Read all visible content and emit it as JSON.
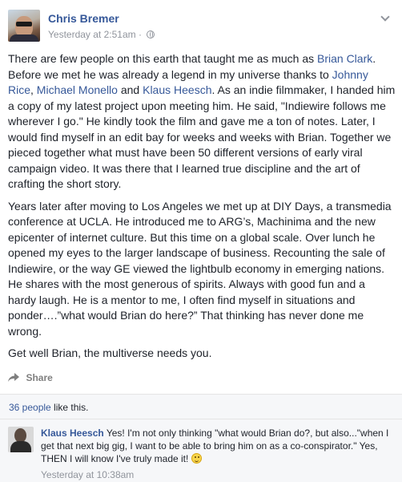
{
  "post": {
    "author": "Chris Bremer",
    "timestamp": "Yesterday at 2:51am",
    "separator": "·",
    "privacy_icon": "globe-icon",
    "options_icon": "chevron-down-icon",
    "paragraphs": [
      {
        "segments": [
          {
            "text": "There are few people on this earth that taught me as much as ",
            "link": false
          },
          {
            "text": "Brian Clark",
            "link": true
          },
          {
            "text": ". Before we met he was already a legend in my universe thanks to ",
            "link": false
          },
          {
            "text": "Johnny Rice",
            "link": true
          },
          {
            "text": ", ",
            "link": false
          },
          {
            "text": "Michael Monello",
            "link": true
          },
          {
            "text": " and ",
            "link": false
          },
          {
            "text": "Klaus Heesch",
            "link": true
          },
          {
            "text": ". As an indie filmmaker, I handed him a copy of my latest project upon meeting him. He said, \"Indiewire follows me wherever I go.\" He kindly took the film and gave me a ton of notes. Later, I would find myself in an edit bay for weeks and weeks with Brian. Together we pieced together what must have been 50 different versions of early viral campaign video. It was there that I learned true discipline and the art of crafting the short story.",
            "link": false
          }
        ]
      },
      {
        "segments": [
          {
            "text": "Years later after moving to Los Angeles we met up at DIY Days, a transmedia conference at UCLA. He introduced me to ARG’s, Machinima and the new epicenter of internet culture. But this time on a global scale. Over lunch he opened my eyes to the larger landscape of business. Recounting the sale of Indiewire, or the way GE viewed the lightbulb economy in emerging nations. He shares with the most generous of spirits. Always with good fun and a hardy laugh. He is a mentor to me, I often find myself in situations and ponder….”what would Brian do here?” That thinking has never done me wrong.",
            "link": false
          }
        ]
      },
      {
        "segments": [
          {
            "text": "Get well Brian, the multiverse needs you.",
            "link": false
          }
        ]
      }
    ]
  },
  "actions": {
    "share_label": "Share",
    "share_icon": "share-arrow-icon"
  },
  "likes": {
    "count_label": "36 people",
    "suffix": " like this."
  },
  "comment": {
    "author": "Klaus Heesch",
    "text": " Yes! I'm not only thinking \"what would Brian do?, but also...\"when I get that next big gig, I want to be able to bring him on as a co-conspirator.\" Yes, THEN I will know I've truly made it! ",
    "emoji_icon": "smiley-icon",
    "timestamp": "Yesterday at 10:38am"
  },
  "colors": {
    "link": "#365899",
    "text": "#1d2129",
    "meta": "#90949c",
    "footer_bg": "#f6f7f9"
  }
}
